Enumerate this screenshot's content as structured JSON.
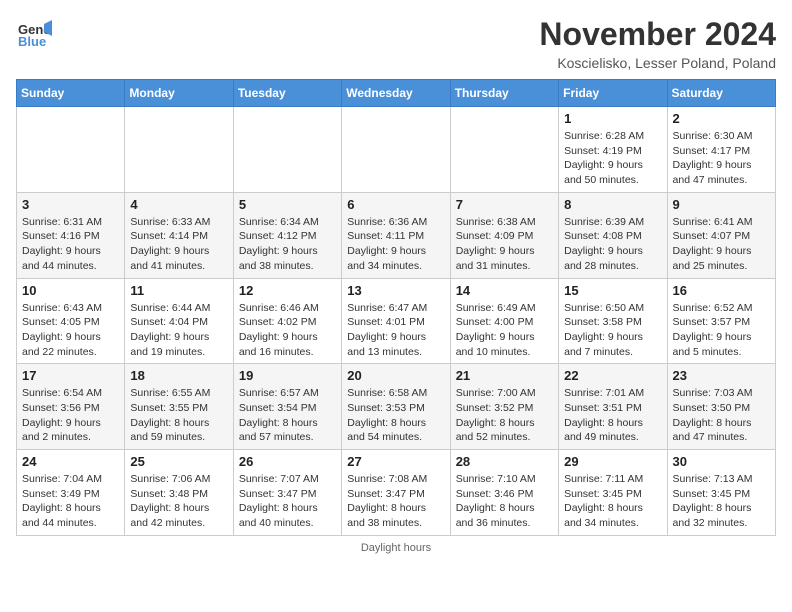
{
  "header": {
    "logo_line1": "General",
    "logo_line2": "Blue",
    "month": "November 2024",
    "location": "Koscielisko, Lesser Poland, Poland"
  },
  "days_of_week": [
    "Sunday",
    "Monday",
    "Tuesday",
    "Wednesday",
    "Thursday",
    "Friday",
    "Saturday"
  ],
  "footer": "Daylight hours",
  "weeks": [
    [
      {
        "day": "",
        "sunrise": "",
        "sunset": "",
        "daylight": ""
      },
      {
        "day": "",
        "sunrise": "",
        "sunset": "",
        "daylight": ""
      },
      {
        "day": "",
        "sunrise": "",
        "sunset": "",
        "daylight": ""
      },
      {
        "day": "",
        "sunrise": "",
        "sunset": "",
        "daylight": ""
      },
      {
        "day": "",
        "sunrise": "",
        "sunset": "",
        "daylight": ""
      },
      {
        "day": "1",
        "sunrise": "Sunrise: 6:28 AM",
        "sunset": "Sunset: 4:19 PM",
        "daylight": "Daylight: 9 hours and 50 minutes."
      },
      {
        "day": "2",
        "sunrise": "Sunrise: 6:30 AM",
        "sunset": "Sunset: 4:17 PM",
        "daylight": "Daylight: 9 hours and 47 minutes."
      }
    ],
    [
      {
        "day": "3",
        "sunrise": "Sunrise: 6:31 AM",
        "sunset": "Sunset: 4:16 PM",
        "daylight": "Daylight: 9 hours and 44 minutes."
      },
      {
        "day": "4",
        "sunrise": "Sunrise: 6:33 AM",
        "sunset": "Sunset: 4:14 PM",
        "daylight": "Daylight: 9 hours and 41 minutes."
      },
      {
        "day": "5",
        "sunrise": "Sunrise: 6:34 AM",
        "sunset": "Sunset: 4:12 PM",
        "daylight": "Daylight: 9 hours and 38 minutes."
      },
      {
        "day": "6",
        "sunrise": "Sunrise: 6:36 AM",
        "sunset": "Sunset: 4:11 PM",
        "daylight": "Daylight: 9 hours and 34 minutes."
      },
      {
        "day": "7",
        "sunrise": "Sunrise: 6:38 AM",
        "sunset": "Sunset: 4:09 PM",
        "daylight": "Daylight: 9 hours and 31 minutes."
      },
      {
        "day": "8",
        "sunrise": "Sunrise: 6:39 AM",
        "sunset": "Sunset: 4:08 PM",
        "daylight": "Daylight: 9 hours and 28 minutes."
      },
      {
        "day": "9",
        "sunrise": "Sunrise: 6:41 AM",
        "sunset": "Sunset: 4:07 PM",
        "daylight": "Daylight: 9 hours and 25 minutes."
      }
    ],
    [
      {
        "day": "10",
        "sunrise": "Sunrise: 6:43 AM",
        "sunset": "Sunset: 4:05 PM",
        "daylight": "Daylight: 9 hours and 22 minutes."
      },
      {
        "day": "11",
        "sunrise": "Sunrise: 6:44 AM",
        "sunset": "Sunset: 4:04 PM",
        "daylight": "Daylight: 9 hours and 19 minutes."
      },
      {
        "day": "12",
        "sunrise": "Sunrise: 6:46 AM",
        "sunset": "Sunset: 4:02 PM",
        "daylight": "Daylight: 9 hours and 16 minutes."
      },
      {
        "day": "13",
        "sunrise": "Sunrise: 6:47 AM",
        "sunset": "Sunset: 4:01 PM",
        "daylight": "Daylight: 9 hours and 13 minutes."
      },
      {
        "day": "14",
        "sunrise": "Sunrise: 6:49 AM",
        "sunset": "Sunset: 4:00 PM",
        "daylight": "Daylight: 9 hours and 10 minutes."
      },
      {
        "day": "15",
        "sunrise": "Sunrise: 6:50 AM",
        "sunset": "Sunset: 3:58 PM",
        "daylight": "Daylight: 9 hours and 7 minutes."
      },
      {
        "day": "16",
        "sunrise": "Sunrise: 6:52 AM",
        "sunset": "Sunset: 3:57 PM",
        "daylight": "Daylight: 9 hours and 5 minutes."
      }
    ],
    [
      {
        "day": "17",
        "sunrise": "Sunrise: 6:54 AM",
        "sunset": "Sunset: 3:56 PM",
        "daylight": "Daylight: 9 hours and 2 minutes."
      },
      {
        "day": "18",
        "sunrise": "Sunrise: 6:55 AM",
        "sunset": "Sunset: 3:55 PM",
        "daylight": "Daylight: 8 hours and 59 minutes."
      },
      {
        "day": "19",
        "sunrise": "Sunrise: 6:57 AM",
        "sunset": "Sunset: 3:54 PM",
        "daylight": "Daylight: 8 hours and 57 minutes."
      },
      {
        "day": "20",
        "sunrise": "Sunrise: 6:58 AM",
        "sunset": "Sunset: 3:53 PM",
        "daylight": "Daylight: 8 hours and 54 minutes."
      },
      {
        "day": "21",
        "sunrise": "Sunrise: 7:00 AM",
        "sunset": "Sunset: 3:52 PM",
        "daylight": "Daylight: 8 hours and 52 minutes."
      },
      {
        "day": "22",
        "sunrise": "Sunrise: 7:01 AM",
        "sunset": "Sunset: 3:51 PM",
        "daylight": "Daylight: 8 hours and 49 minutes."
      },
      {
        "day": "23",
        "sunrise": "Sunrise: 7:03 AM",
        "sunset": "Sunset: 3:50 PM",
        "daylight": "Daylight: 8 hours and 47 minutes."
      }
    ],
    [
      {
        "day": "24",
        "sunrise": "Sunrise: 7:04 AM",
        "sunset": "Sunset: 3:49 PM",
        "daylight": "Daylight: 8 hours and 44 minutes."
      },
      {
        "day": "25",
        "sunrise": "Sunrise: 7:06 AM",
        "sunset": "Sunset: 3:48 PM",
        "daylight": "Daylight: 8 hours and 42 minutes."
      },
      {
        "day": "26",
        "sunrise": "Sunrise: 7:07 AM",
        "sunset": "Sunset: 3:47 PM",
        "daylight": "Daylight: 8 hours and 40 minutes."
      },
      {
        "day": "27",
        "sunrise": "Sunrise: 7:08 AM",
        "sunset": "Sunset: 3:47 PM",
        "daylight": "Daylight: 8 hours and 38 minutes."
      },
      {
        "day": "28",
        "sunrise": "Sunrise: 7:10 AM",
        "sunset": "Sunset: 3:46 PM",
        "daylight": "Daylight: 8 hours and 36 minutes."
      },
      {
        "day": "29",
        "sunrise": "Sunrise: 7:11 AM",
        "sunset": "Sunset: 3:45 PM",
        "daylight": "Daylight: 8 hours and 34 minutes."
      },
      {
        "day": "30",
        "sunrise": "Sunrise: 7:13 AM",
        "sunset": "Sunset: 3:45 PM",
        "daylight": "Daylight: 8 hours and 32 minutes."
      }
    ]
  ]
}
